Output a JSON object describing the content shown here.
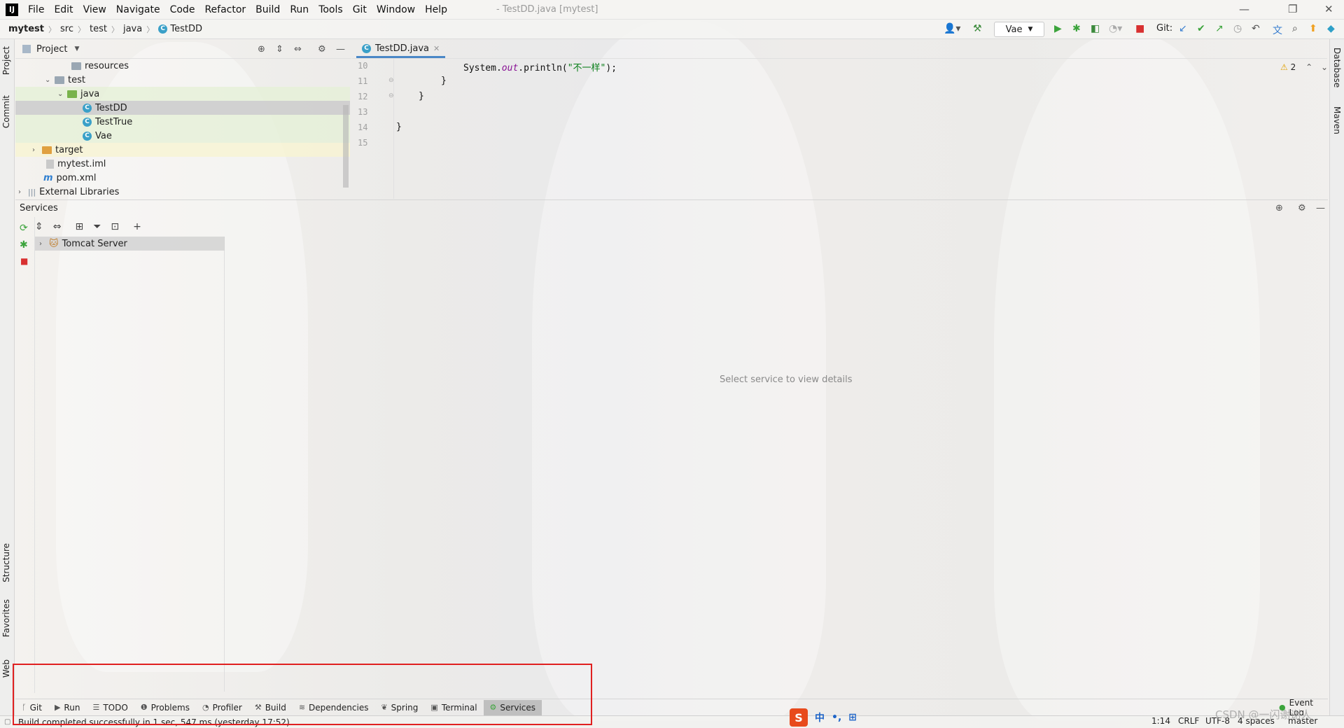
{
  "menu": {
    "items": [
      "File",
      "Edit",
      "View",
      "Navigate",
      "Code",
      "Refactor",
      "Build",
      "Run",
      "Tools",
      "Git",
      "Window",
      "Help"
    ],
    "window_title": "- TestDD.java [mytest]"
  },
  "breadcrumb": [
    "mytest",
    "src",
    "test",
    "java",
    "TestDD"
  ],
  "toolbar": {
    "run_config": "Vae",
    "git_label": "Git:"
  },
  "left_stripe": {
    "project": "Project",
    "commit": "Commit",
    "structure": "Structure",
    "favorites": "Favorites",
    "web": "Web"
  },
  "right_stripe": {
    "database": "Database",
    "maven": "Maven"
  },
  "project": {
    "title": "Project",
    "tree": [
      {
        "label": "resources",
        "kind": "folder"
      },
      {
        "label": "test",
        "kind": "folder"
      },
      {
        "label": "java",
        "kind": "folder-green"
      },
      {
        "label": "TestDD",
        "kind": "class"
      },
      {
        "label": "TestTrue",
        "kind": "class"
      },
      {
        "label": "Vae",
        "kind": "class"
      },
      {
        "label": "target",
        "kind": "folder-orange"
      },
      {
        "label": "mytest.iml",
        "kind": "file"
      },
      {
        "label": "pom.xml",
        "kind": "file"
      },
      {
        "label": "External Libraries",
        "kind": "lib"
      }
    ]
  },
  "editor": {
    "tab_label": "TestDD.java",
    "line_numbers": [
      "10",
      "11",
      "12",
      "13",
      "14",
      "15"
    ],
    "code": {
      "l10_a": "System.",
      "l10_b": "out",
      "l10_c": ".println(",
      "l10_d": "\"不一样\"",
      "l10_e": ");",
      "l11": "}",
      "l12": "}",
      "l14": "}"
    },
    "warnings": "2"
  },
  "services": {
    "title": "Services",
    "tree_item": "Tomcat Server",
    "empty_text": "Select service to view details"
  },
  "bottom_tools": [
    {
      "label": "Git",
      "icon": "git-icon"
    },
    {
      "label": "Run",
      "icon": "run-icon"
    },
    {
      "label": "TODO",
      "icon": "todo-icon"
    },
    {
      "label": "Problems",
      "icon": "problems-icon"
    },
    {
      "label": "Profiler",
      "icon": "profiler-icon"
    },
    {
      "label": "Build",
      "icon": "build-icon"
    },
    {
      "label": "Dependencies",
      "icon": "dependencies-icon"
    },
    {
      "label": "Spring",
      "icon": "spring-icon"
    },
    {
      "label": "Terminal",
      "icon": "terminal-icon"
    },
    {
      "label": "Services",
      "icon": "services-icon"
    }
  ],
  "event_log": "Event Log",
  "status": {
    "message": "Build completed successfully in 1 sec, 547 ms (yesterday 17:52)",
    "position": "1:14",
    "line_sep": "CRLF",
    "encoding": "UTF-8",
    "indent": "4 spaces",
    "branch": "master",
    "watermark": "CSDN @一闪谢谢人"
  },
  "ime": {
    "zh": "中",
    "punct": "•,"
  }
}
